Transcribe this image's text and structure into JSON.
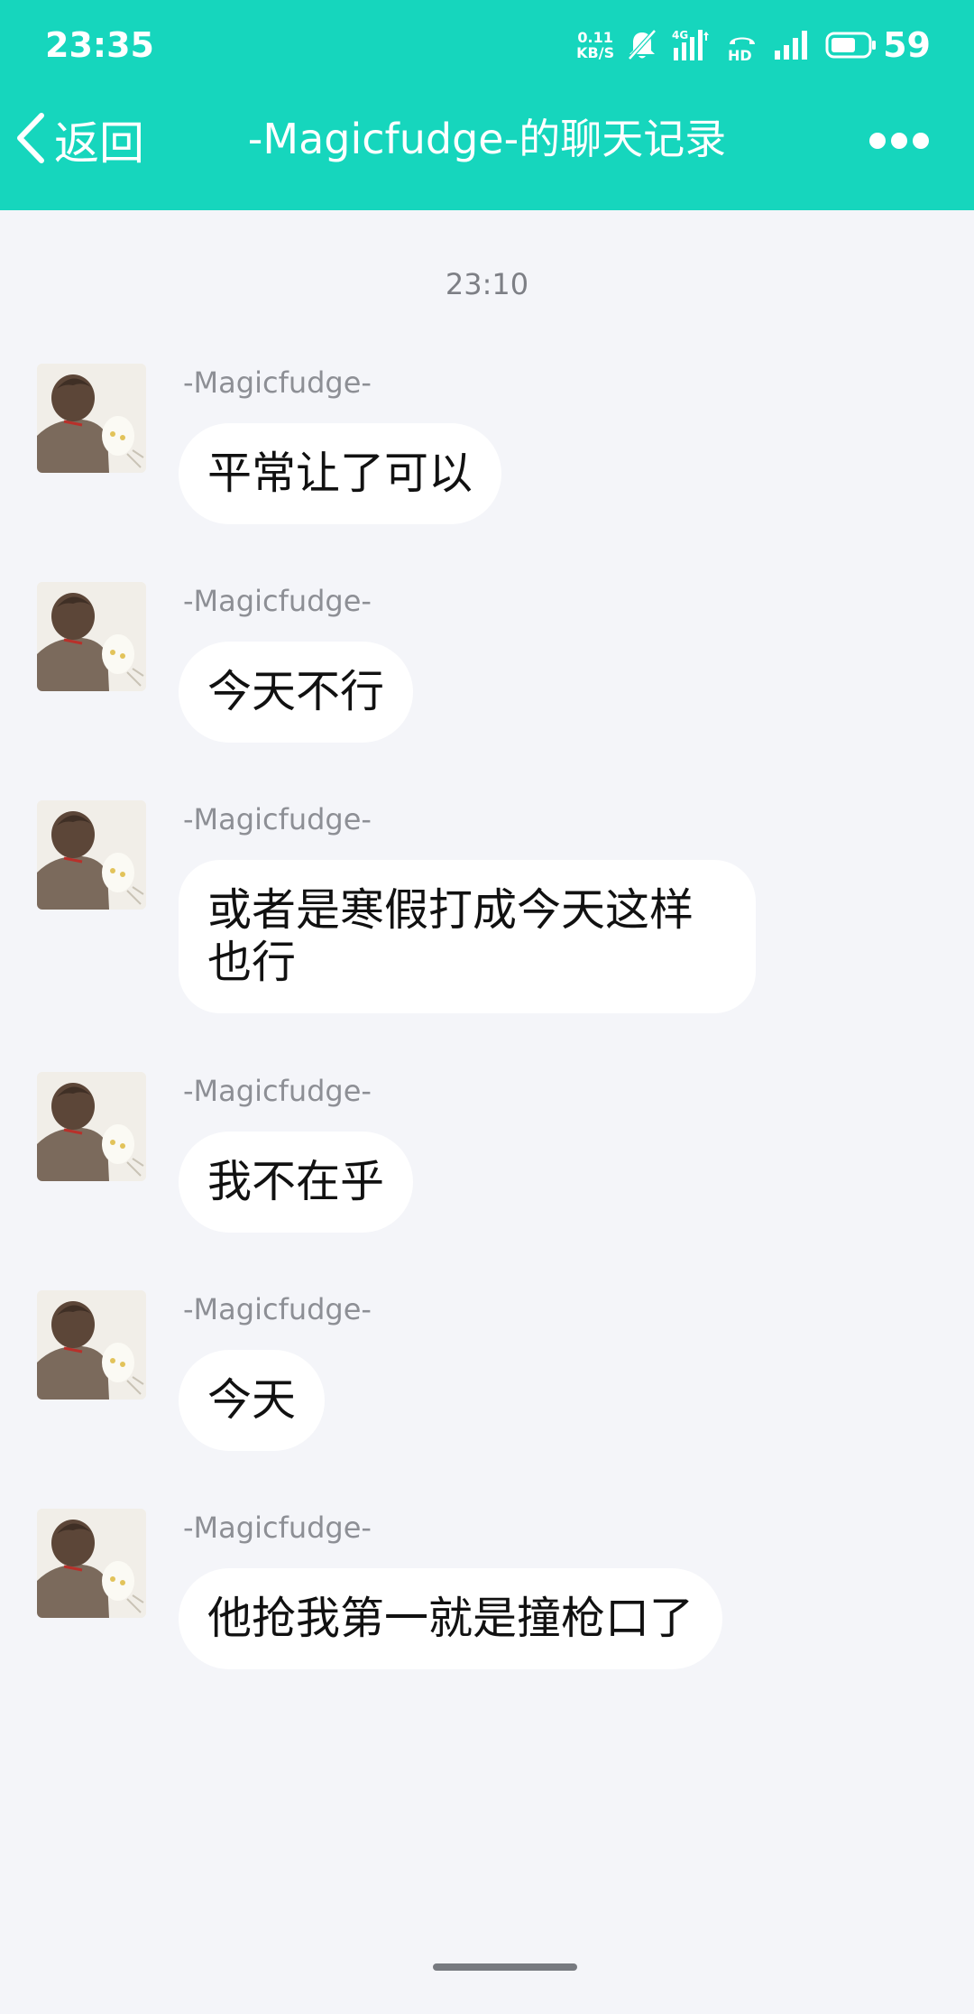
{
  "colors": {
    "header": "#16d6bd",
    "background": "#f4f5f9",
    "bubble": "#ffffff"
  },
  "status_bar": {
    "time": "23:35",
    "net_speed_value": "0.11",
    "net_speed_unit": "KB/S",
    "network_type": "4G",
    "hd_label": "HD",
    "battery": "59",
    "icons": [
      "mute-bell-icon",
      "mobile-data-icon",
      "hd-call-icon",
      "signal-icon",
      "battery-icon"
    ]
  },
  "nav": {
    "back_label": "返回",
    "title": "-Magicfudge-的聊天记录",
    "more_icon": "more-dots-icon"
  },
  "chat": {
    "timestamp": "23:10",
    "messages": [
      {
        "sender": "-Magicfudge-",
        "text": "平常让了可以"
      },
      {
        "sender": "-Magicfudge-",
        "text": "今天不行"
      },
      {
        "sender": "-Magicfudge-",
        "text": "或者是寒假打成今天这样也行"
      },
      {
        "sender": "-Magicfudge-",
        "text": "我不在乎"
      },
      {
        "sender": "-Magicfudge-",
        "text": "今天"
      },
      {
        "sender": "-Magicfudge-",
        "text": "他抢我第一就是撞枪口了"
      }
    ]
  }
}
